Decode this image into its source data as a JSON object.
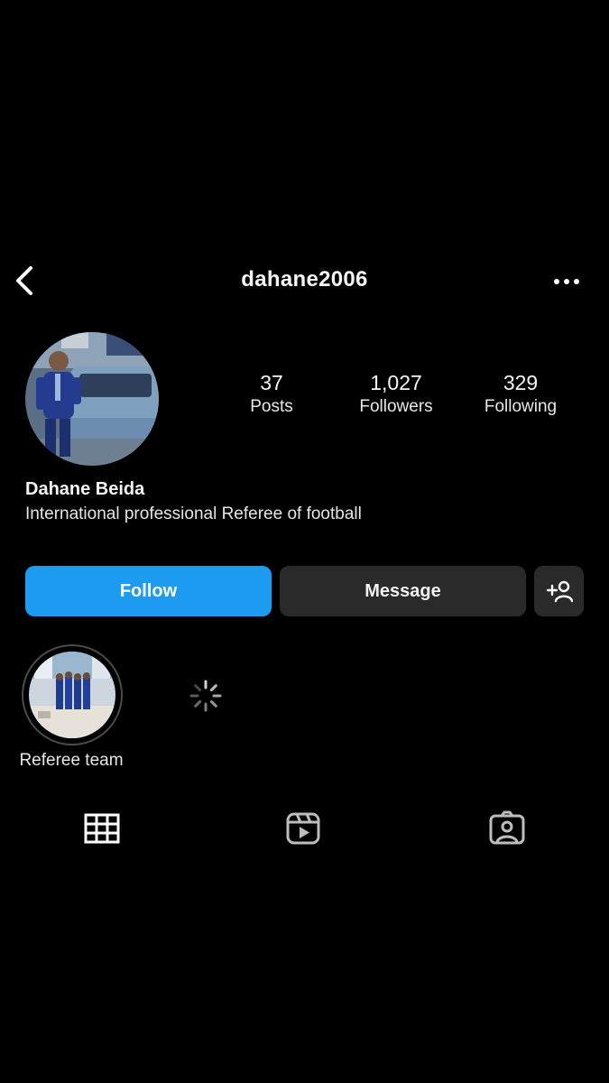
{
  "header": {
    "username": "dahane2006"
  },
  "profile": {
    "full_name": "Dahane Beida",
    "bio": "International professional Referee of football"
  },
  "stats": [
    {
      "value": "37",
      "label": "Posts"
    },
    {
      "value": "1,027",
      "label": "Followers"
    },
    {
      "value": "329",
      "label": "Following"
    }
  ],
  "actions": {
    "follow_label": "Follow",
    "message_label": "Message"
  },
  "highlights": [
    {
      "label": "Referee team"
    }
  ],
  "tabs": [
    {
      "icon": "grid-icon"
    },
    {
      "icon": "reels-icon"
    },
    {
      "icon": "tagged-icon"
    }
  ],
  "colors": {
    "background": "#000000",
    "follow_button": "#1d9bf0",
    "secondary_button": "#2a2a2a"
  }
}
